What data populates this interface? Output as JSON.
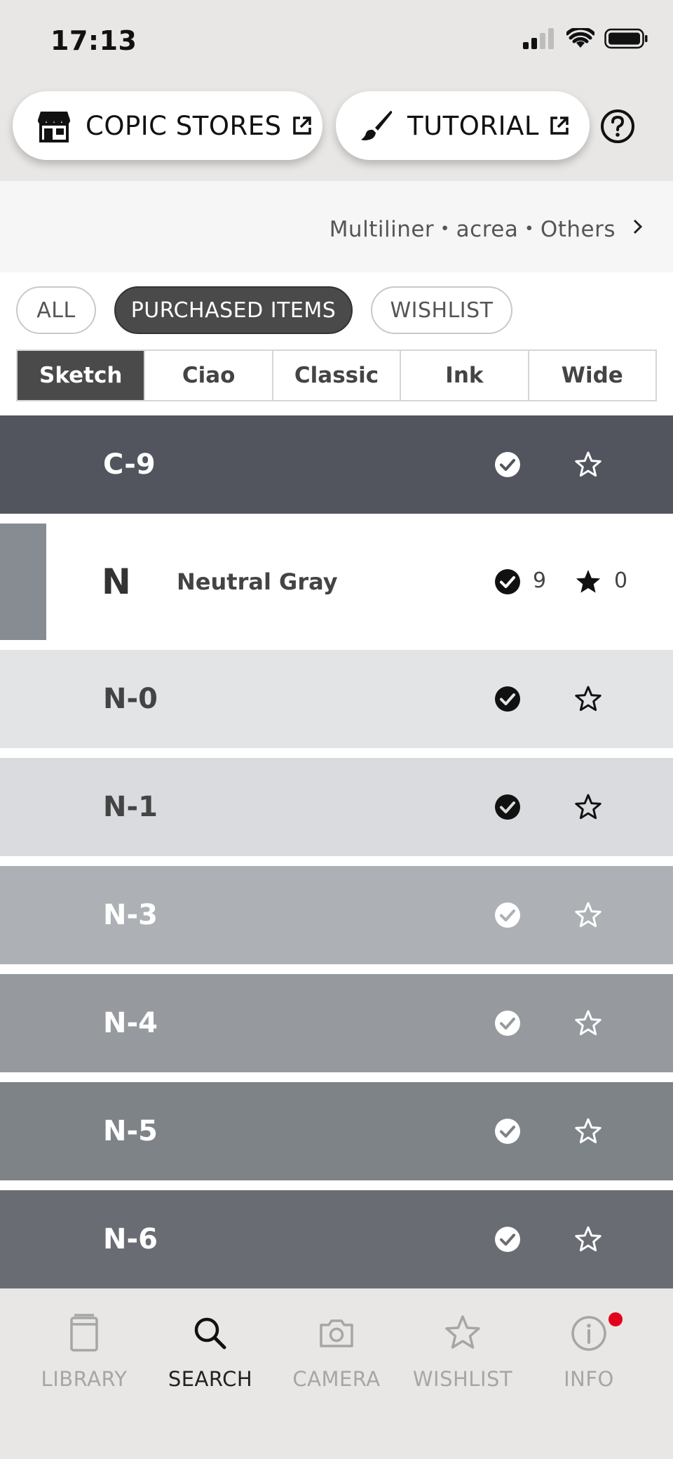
{
  "status_bar": {
    "time": "17:13"
  },
  "top_buttons": {
    "stores_label": "COPIC STORES",
    "tutorial_label": "TUTORIAL"
  },
  "breadcrumb": {
    "text": "Multiliner・acrea・Others"
  },
  "filters": {
    "all": "ALL",
    "purchased": "PURCHASED ITEMS",
    "wishlist": "WISHLIST",
    "active": "purchased"
  },
  "tabs": [
    "Sketch",
    "Ciao",
    "Classic",
    "Ink",
    "Wide"
  ],
  "active_tab": "Sketch",
  "colors": {
    "accent_dark": "#4a4a4a",
    "badge_red": "#e3001b",
    "C-9": "#52545e",
    "N": "#878c93",
    "N-0": "#e3e4e6",
    "N-1": "#d9dbde",
    "N-3": "#adb1b6",
    "N-4": "#969a9f",
    "N-5": "#7e8388",
    "N-6": "#696d73"
  },
  "list": {
    "c9": {
      "code": "C-9",
      "purchased": true,
      "wishlisted": false
    },
    "group": {
      "letter": "N",
      "name": "Neutral Gray",
      "purchased_count": "9",
      "wishlist_count": "0"
    },
    "items": [
      {
        "code": "N-0",
        "purchased": true,
        "wishlisted": false
      },
      {
        "code": "N-1",
        "purchased": true,
        "wishlisted": false
      },
      {
        "code": "N-3",
        "purchased": true,
        "wishlisted": false
      },
      {
        "code": "N-4",
        "purchased": true,
        "wishlisted": false
      },
      {
        "code": "N-5",
        "purchased": true,
        "wishlisted": false
      },
      {
        "code": "N-6",
        "purchased": true,
        "wishlisted": false
      }
    ]
  },
  "bottom_nav": {
    "library": "LIBRARY",
    "search": "SEARCH",
    "camera": "CAMERA",
    "wishlist": "WISHLIST",
    "info": "INFO",
    "active": "search"
  }
}
